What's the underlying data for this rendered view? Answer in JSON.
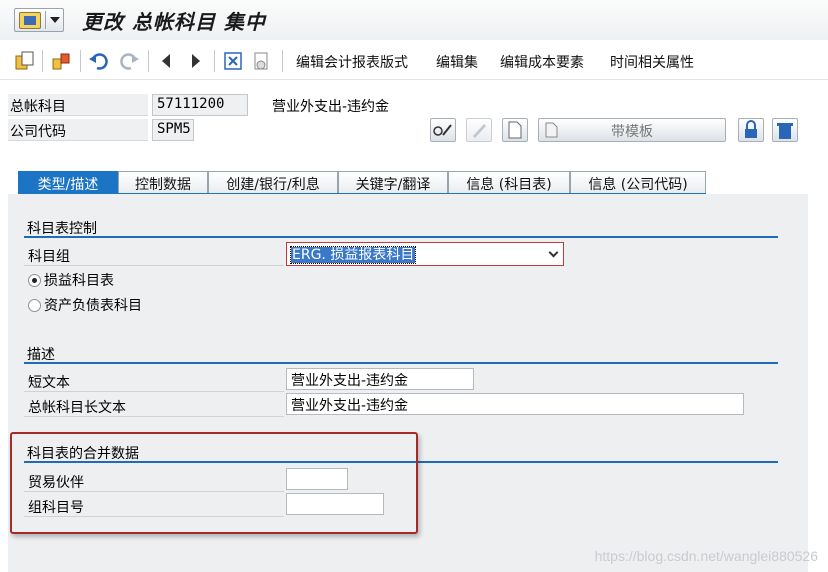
{
  "window": {
    "title": "更改 总帐科目 集中"
  },
  "toolbar": {
    "buttons": [
      "编辑会计报表版式",
      "编辑集",
      "编辑成本要素",
      "时间相关属性"
    ]
  },
  "header": {
    "account_label": "总帐科目",
    "account_value": "57111200",
    "account_desc": "营业外支出-违约金",
    "company_label": "公司代码",
    "company_value": "SPM5",
    "template_button": "带模板"
  },
  "tabs": [
    "类型/描述",
    "控制数据",
    "创建/银行/利息",
    "关键字/翻译",
    "信息 (科目表)",
    "信息 (公司代码)"
  ],
  "sections": {
    "coa_control": {
      "title": "科目表控制",
      "group_label": "科目组",
      "group_value": "ERG. 损益报表科目",
      "radio_pl": "损益科目表",
      "radio_bs": "资产负债表科目"
    },
    "description": {
      "title": "描述",
      "short_label": "短文本",
      "short_value": "营业外支出-违约金",
      "long_label": "总帐科目长文本",
      "long_value": "营业外支出-违约金"
    },
    "consolidation": {
      "title": "科目表的合并数据",
      "partner_label": "贸易伙伴",
      "partner_value": "",
      "group_acct_label": "组科目号",
      "group_acct_value": ""
    }
  },
  "watermark": "https://blog.csdn.net/wanglei880526"
}
